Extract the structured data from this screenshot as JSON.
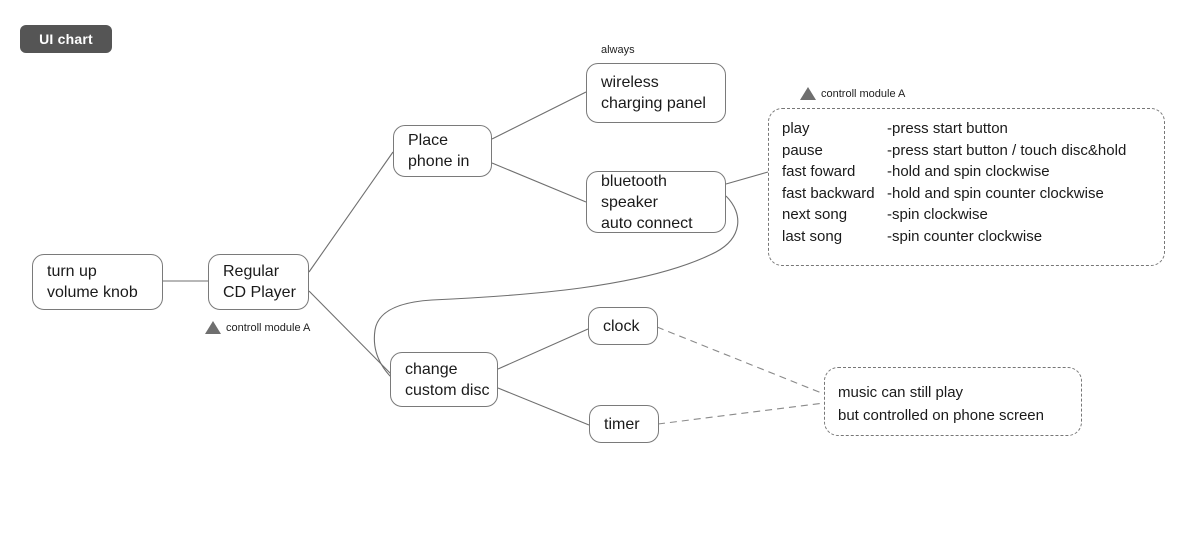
{
  "badge": {
    "label": "UI chart"
  },
  "nodes": {
    "volume": {
      "line1": "turn up",
      "line2": "volume knob"
    },
    "cd_player": {
      "line1": "Regular",
      "line2": "CD Player"
    },
    "place_phone": {
      "line1": "Place",
      "line2": "phone in"
    },
    "wireless": {
      "line1": "wireless",
      "line2": "charging panel"
    },
    "bluetooth": {
      "line1": "bluetooth",
      "line2": "speaker",
      "line3": "auto connect"
    },
    "change_disc": {
      "line1": "change",
      "line2": "custom disc"
    },
    "clock": {
      "line1": "clock"
    },
    "timer": {
      "line1": "timer"
    }
  },
  "labels": {
    "always": "always",
    "module_cd": "controll module A",
    "module_panel": "controll module A"
  },
  "control_module": {
    "title": "controll module A",
    "rows": [
      {
        "action": "play",
        "desc": "-press start button"
      },
      {
        "action": "pause",
        "desc": "-press start button / touch disc&hold"
      },
      {
        "action": "fast foward",
        "desc": "-hold and spin clockwise"
      },
      {
        "action": "fast backward",
        "desc": "-hold and spin counter clockwise"
      },
      {
        "action": "next song",
        "desc": "-spin clockwise"
      },
      {
        "action": "last song",
        "desc": "-spin counter clockwise"
      }
    ]
  },
  "note": {
    "line1": "music can still play",
    "line2": "but controlled on phone screen"
  },
  "colors": {
    "badge_bg": "#555555",
    "badge_text": "#ffffff",
    "node_border": "#7a7a7a",
    "edge": "#6f6f6f",
    "text": "#1a1a1a"
  }
}
